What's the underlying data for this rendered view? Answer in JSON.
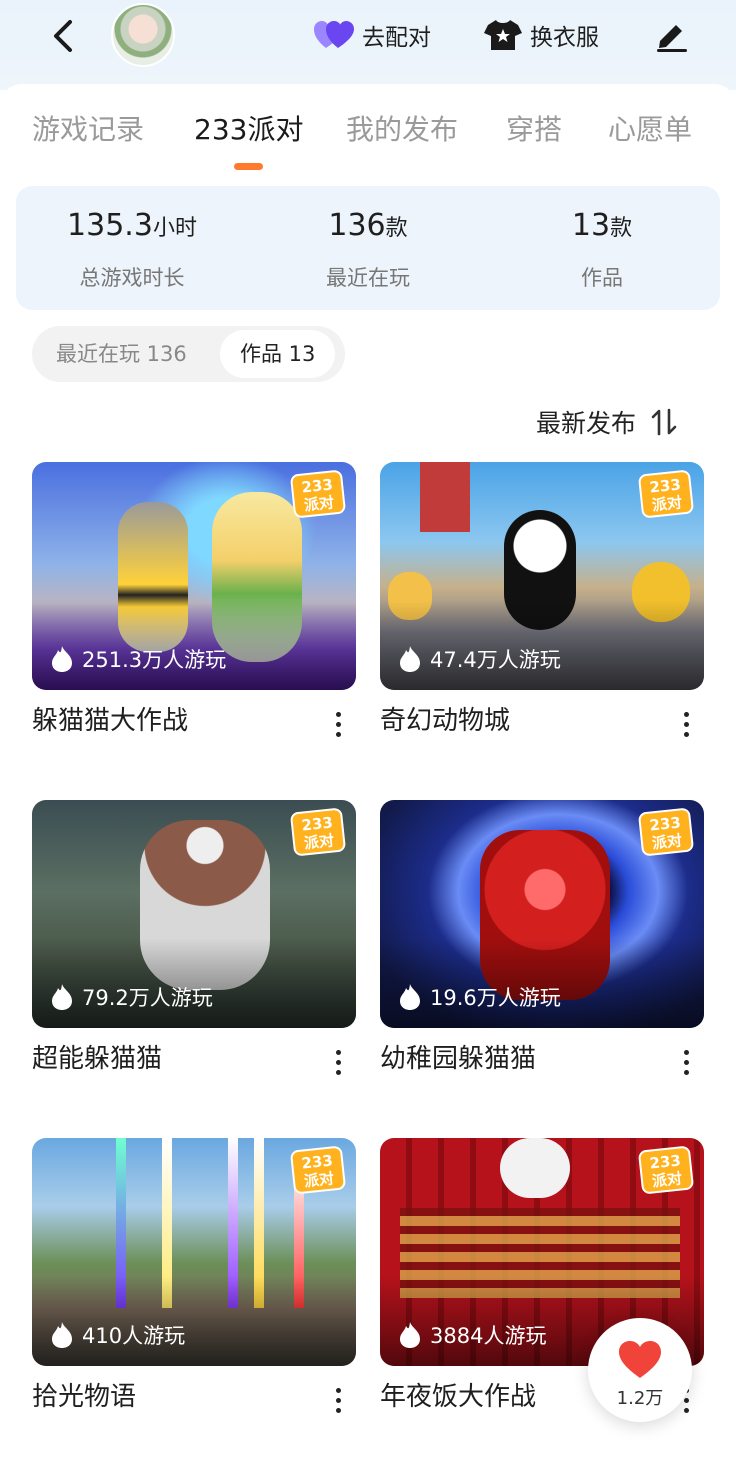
{
  "header": {
    "back_icon": "chevron-left-icon",
    "avatar_icon": "avatar-image",
    "match_label": "去配对",
    "match_icon": "heart-pair-icon",
    "wardrobe_label": "换衣服",
    "wardrobe_icon": "tshirt-star-icon",
    "edit_icon": "pencil-icon"
  },
  "tabs": [
    {
      "label": "游戏记录",
      "active": false
    },
    {
      "label": "233派对",
      "active": true
    },
    {
      "label": "我的发布",
      "active": false
    },
    {
      "label": "穿搭",
      "active": false
    },
    {
      "label": "心愿单",
      "active": false
    }
  ],
  "stats": [
    {
      "value": "135.3",
      "unit": "小时",
      "label": "总游戏时长"
    },
    {
      "value": "136",
      "unit": "款",
      "label": "最近在玩"
    },
    {
      "value": "13",
      "unit": "款",
      "label": "作品"
    }
  ],
  "segment": [
    {
      "label": "最近在玩 136",
      "active": false
    },
    {
      "label": "作品 13",
      "active": true
    }
  ],
  "sort": {
    "label": "最新发布",
    "icon": "sort-arrows-icon"
  },
  "badge_text": {
    "line1": "233",
    "line2": "派对"
  },
  "games": [
    {
      "title": "躲猫猫大作战",
      "plays": "251.3万人游玩"
    },
    {
      "title": "奇幻动物城",
      "plays": "47.4万人游玩"
    },
    {
      "title": "超能躲猫猫",
      "plays": "79.2万人游玩"
    },
    {
      "title": "幼稚园躲猫猫",
      "plays": "19.6万人游玩"
    },
    {
      "title": "拾光物语",
      "plays": "410人游玩"
    },
    {
      "title": "年夜饭大作战",
      "plays": "3884人游玩"
    }
  ],
  "like": {
    "count": "1.2万",
    "icon": "heart-icon"
  },
  "colors": {
    "accent": "#ff7a2e",
    "badge": "#ffb21e",
    "heart": "#f0443a",
    "match": "#7b5cff"
  }
}
